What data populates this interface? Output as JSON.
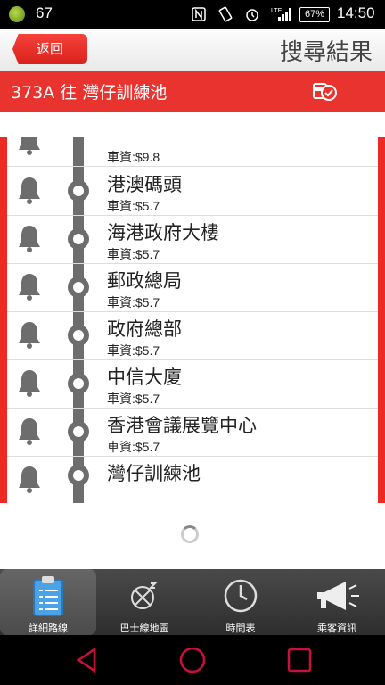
{
  "status_bar": {
    "notification_count": "67",
    "battery": "67%",
    "network": "LTE",
    "time": "14:50"
  },
  "header": {
    "back_label": "返回",
    "title": "搜尋結果"
  },
  "route": {
    "title": "373A 往 灣仔訓練池"
  },
  "partial_stop": {
    "fare": "車資:$9.8"
  },
  "stops": [
    {
      "name": "港澳碼頭",
      "fare": "車資:$5.7"
    },
    {
      "name": "海港政府大樓",
      "fare": "車資:$5.7"
    },
    {
      "name": "郵政總局",
      "fare": "車資:$5.7"
    },
    {
      "name": "政府總部",
      "fare": "車資:$5.7"
    },
    {
      "name": "中信大廈",
      "fare": "車資:$5.7"
    },
    {
      "name": "香港會議展覽中心",
      "fare": "車資:$5.7"
    },
    {
      "name": "灣仔訓練池",
      "fare": ""
    }
  ],
  "tabs": [
    {
      "label": "詳細路線",
      "icon": "clipboard-list-icon",
      "active": true
    },
    {
      "label": "巴士線地圖",
      "icon": "map-pin-icon",
      "active": false
    },
    {
      "label": "時間表",
      "icon": "clock-icon",
      "active": false
    },
    {
      "label": "乘客資訊",
      "icon": "megaphone-icon",
      "active": false
    }
  ],
  "colors": {
    "accent_red": "#e8332f",
    "route_line": "#6d6d6d"
  }
}
